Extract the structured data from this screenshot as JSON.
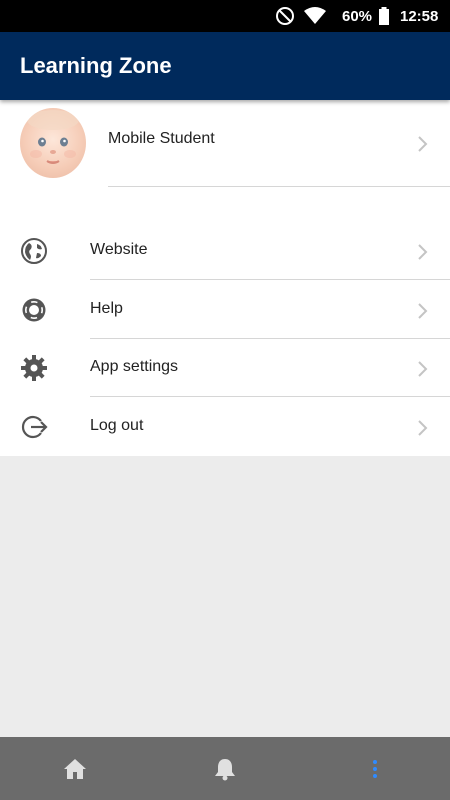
{
  "status_bar": {
    "battery_text": "60%",
    "time": "12:58",
    "icons": [
      "do-not-disturb-icon",
      "wifi-icon",
      "battery-icon"
    ]
  },
  "app_bar": {
    "title": "Learning Zone"
  },
  "profile": {
    "name": "Mobile Student"
  },
  "menu": {
    "items": [
      {
        "label": "Website",
        "icon": "globe-icon"
      },
      {
        "label": "Help",
        "icon": "lifebuoy-icon"
      },
      {
        "label": "App settings",
        "icon": "gear-icon"
      },
      {
        "label": "Log out",
        "icon": "logout-icon"
      }
    ]
  },
  "bottom_nav": {
    "items": [
      {
        "icon": "home-icon"
      },
      {
        "icon": "bell-icon"
      },
      {
        "icon": "more-vertical-icon",
        "active": true
      }
    ]
  },
  "colors": {
    "app_bar": "#002a5c",
    "active_nav": "#2f8bff",
    "nav_bg": "#6b6b6b",
    "page_bg": "#ececec"
  }
}
